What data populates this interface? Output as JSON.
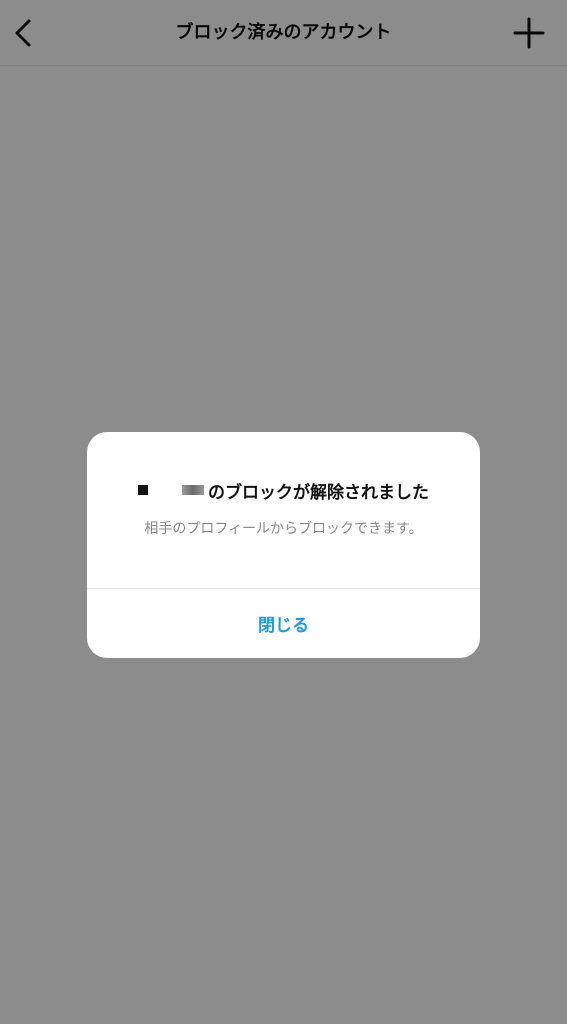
{
  "header": {
    "title": "ブロック済みのアカウント",
    "back_icon": "chevron-left-icon",
    "add_icon": "plus-icon"
  },
  "dialog": {
    "title_suffix": "のブロックが解除されました",
    "message": "相手のプロフィールからブロックできます。",
    "close_label": "閉じる"
  },
  "colors": {
    "accent": "#1a9ae8",
    "overlay": "rgba(0,0,0,0.45)",
    "secondary_text": "#8a8a8a"
  }
}
